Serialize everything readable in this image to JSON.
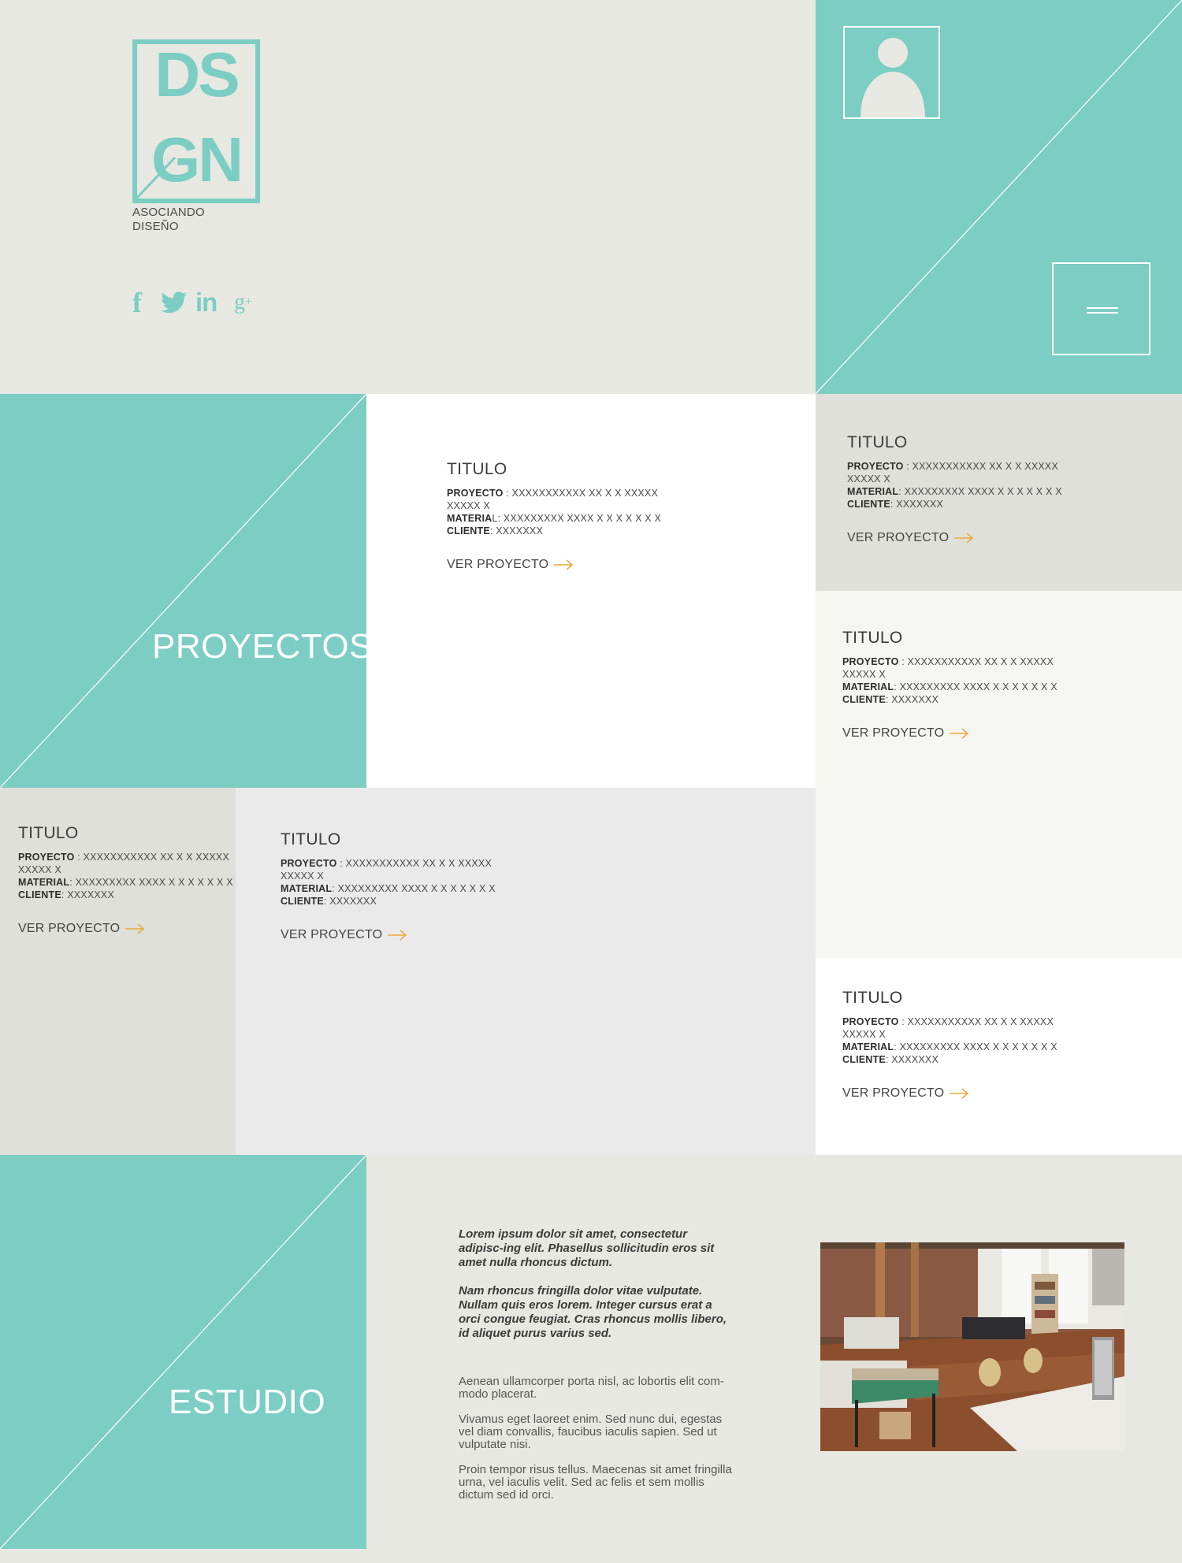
{
  "brand": {
    "logo_letters": "DSGN",
    "tagline_line1": "ASOCIANDO",
    "tagline_line2": "DISEÑO",
    "teal": "#7ccdc3",
    "accent_arrow": "#e9a93c"
  },
  "social": {
    "facebook_label": "f",
    "linkedin_label": "in",
    "googleplus_label": "g",
    "googleplus_sup": "+",
    "icons": [
      "facebook-icon",
      "twitter-icon",
      "linkedin-icon",
      "google-plus-icon"
    ]
  },
  "header": {
    "profile_icon": "user-icon",
    "menu_icon": "hamburger-icon"
  },
  "sections": {
    "projects_heading": "PROYECTOS",
    "studio_heading": "ESTUDIO"
  },
  "project_cards": [
    {
      "title": "TITULO",
      "proyecto_label": "PROYECTO",
      "proyecto_value": " : XXXXXXXXXXX  XX X X  XXXXX",
      "proyecto_value_2": "XXXXX X",
      "material_label": "MATERIA",
      "material_value": "L: XXXXXXXXX XXXX X X X X X X X",
      "cliente_label": "CLIENTE",
      "cliente_value": ": XXXXXXX",
      "link": "VER PROYECTO"
    },
    {
      "title": "TITULO",
      "proyecto_label": "PROYECTO",
      "proyecto_value": " : XXXXXXXXXXX  XX X X  XXXXX",
      "proyecto_value_2": "XXXXX X",
      "material_label": "MATERIAL",
      "material_value": ": XXXXXXXXX XXXX X X X X X X X",
      "cliente_label": "CLIENTE",
      "cliente_value": ": XXXXXXX",
      "link": "VER PROYECTO"
    },
    {
      "title": "TITULO",
      "proyecto_label": "PROYECTO",
      "proyecto_value": " : XXXXXXXXXXX  XX X X  XXXXX",
      "proyecto_value_2": "XXXXX X",
      "material_label": "MATERIAL",
      "material_value": ": XXXXXXXXX XXXX X X X X X X X",
      "cliente_label": "CLIENTE",
      "cliente_value": ": XXXXXXX",
      "link": "VER PROYECTO"
    },
    {
      "title": "TITULO",
      "proyecto_label": "PROYECTO",
      "proyecto_value": " : XXXXXXXXXXX  XX X X  XXXXX",
      "proyecto_value_2": "XXXXX X",
      "material_label": "MATERIAL",
      "material_value": ": XXXXXXXXX XXXX X X X X X X X",
      "cliente_label": "CLIENTE",
      "cliente_value": ": XXXXXXX",
      "link": "VER PROYECTO"
    },
    {
      "title": "TITULO",
      "proyecto_label": "PROYECTO",
      "proyecto_value": " : XXXXXXXXXXX  XX X X  XXXXX",
      "proyecto_value_2": "XXXXX X",
      "material_label": "MATERIAL",
      "material_value": ": XXXXXXXXX XXXX X X X X X X X",
      "cliente_label": "CLIENTE",
      "cliente_value": ": XXXXXXX",
      "link": "VER PROYECTO"
    },
    {
      "title": "TITULO",
      "proyecto_label": "PROYECTO",
      "proyecto_value": " : XXXXXXXXXXX  XX X X  XXXXX",
      "proyecto_value_2": "XXXXX X",
      "material_label": "MATERIAL",
      "material_value": ": XXXXXXXXX XXXX X X X X X X X",
      "cliente_label": "CLIENTE",
      "cliente_value": ": XXXXXXX",
      "link": "VER PROYECTO"
    }
  ],
  "studio": {
    "italic_1": "Lorem ipsum dolor sit amet, consectetur adipisc-ing elit. Phasellus sollicitudin eros sit amet nulla rhoncus dictum.",
    "italic_2": "Nam rhoncus fringilla dolor vitae vulputate. Nullam quis eros lorem. Integer cursus erat a orci congue feugiat. Cras rhoncus mollis libero, id aliquet purus varius sed.",
    "para_1": "Aenean ullamcorper porta nisl, ac lobortis elit com-modo placerat.",
    "para_2": "Vivamus eget laoreet enim. Sed nunc dui, egestas vel diam convallis, faucibus iaculis sapien. Sed ut vulputate nisi.",
    "para_3": "Proin tempor risus tellus. Maecenas sit amet fringilla urna, vel iaculis velit. Sed ac felis et sem mollis dictum sed id orci."
  }
}
